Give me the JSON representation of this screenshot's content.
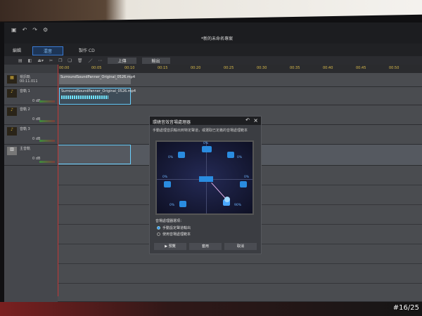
{
  "window": {
    "title": "*新的未命名專案"
  },
  "tabs": [
    {
      "label": "編輯"
    },
    {
      "label": "混音"
    },
    {
      "label": "製作 CD"
    }
  ],
  "toolbar": {
    "upload": "上傳",
    "export": "輸出"
  },
  "ruler": [
    "00:00",
    "00:05",
    "00:10",
    "00:15",
    "00:20",
    "00:25",
    "00:30",
    "00:35",
    "00:40",
    "00:45",
    "00:50"
  ],
  "tracks": [
    {
      "name": "視訊軌",
      "time": "00:11.011"
    },
    {
      "name": "音軌 1",
      "vol": "0 dB"
    },
    {
      "name": "音軌 2",
      "vol": "0 dB"
    },
    {
      "name": "音軌 3",
      "vol": "0 dB"
    },
    {
      "name": "主音軌",
      "vol": "0 dB"
    }
  ],
  "clips": {
    "video": "SurroundSoundPanner_Original_0526.mp4",
    "audio": "SurroundSoundPanner_Original_0526.mp4"
  },
  "dialog": {
    "title": "環繞音效音場處理器",
    "description": "手動處理音訊輸出到特定聲道，或選取已定義的音場處理範本",
    "speakers": {
      "center": "0%",
      "front_left": "0%",
      "front_right": "0%",
      "side_left": "0%",
      "side_right": "0%",
      "rear_left": "0%",
      "rear_right": "90%"
    },
    "options_label": "音場處理器選項：",
    "option_manual": "手動設定聲道輸出",
    "option_template": "使用音場處理範本",
    "selected_option": "manual",
    "preview": "預覽",
    "apply": "套用",
    "cancel": "取消"
  },
  "stamp": "#16/25"
}
